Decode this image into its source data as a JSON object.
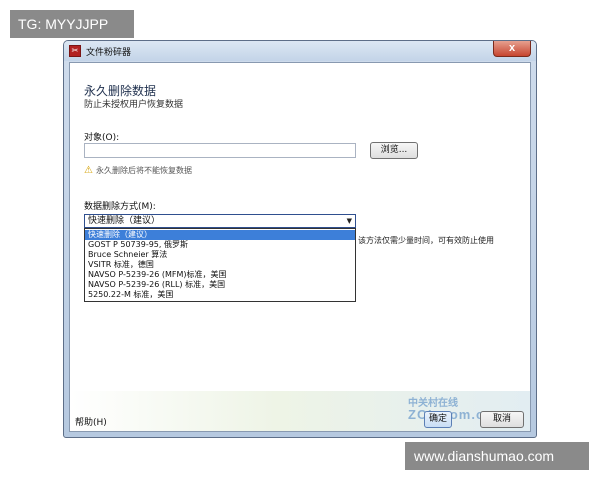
{
  "overlay": {
    "tag_top": "TG: MYYJJPP",
    "tag_bottom": "www.dianshumao.com"
  },
  "window": {
    "title": "文件粉碎器",
    "icon": "shredder-app-icon",
    "close_label": "x"
  },
  "content": {
    "heading": "永久删除数据",
    "subheading": "防止未授权用户恢复数据",
    "target_label": "对象(O):",
    "target_value": "",
    "browse_label": "浏览...",
    "warning_text": "永久删除后将不能恢复数据",
    "method_label": "数据删除方式(M):",
    "method_selected": "快速删除（建议）",
    "method_options": [
      "快速删除（建议）",
      "GOST P 50739-95, 俄罗斯",
      "Bruce Schneier 算法",
      "VSITR 标准，德国",
      "NAVSO P-5239-26 (MFM)标准，美国",
      "NAVSO P-5239-26 (RLL) 标准，美国",
      "5250.22-M 标准，美国"
    ],
    "method_description": "该方法仅需少量时间，可有效防止使用"
  },
  "footer": {
    "help_label": "帮助(H)",
    "ok_label": "确定",
    "cancel_label": "取消",
    "watermark_line1": "中关村在线",
    "watermark_line2": "ZOL.com.cn"
  },
  "colors": {
    "selection": "#3d7fd9",
    "titlebar": "#c3d4e8",
    "close_button": "#c7452f"
  }
}
